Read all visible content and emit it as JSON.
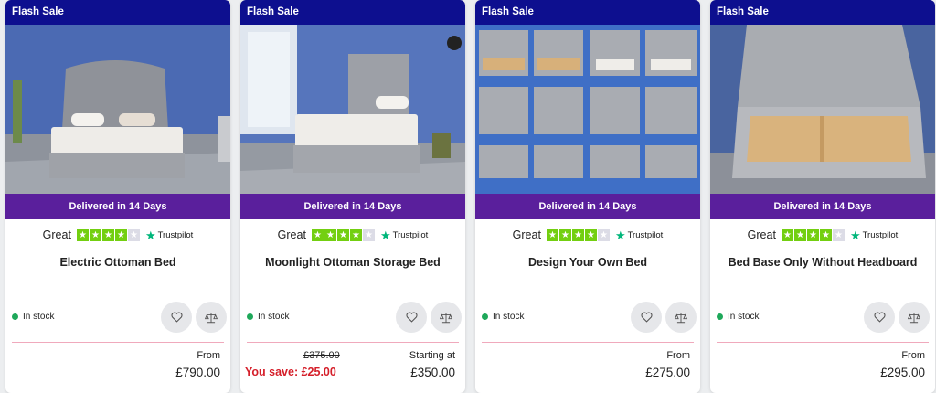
{
  "colors": {
    "flash_bg": "#0d0f8f",
    "delivery_bg": "#5a1f9c",
    "trustpilot_green": "#73cf11",
    "in_stock_dot": "#1ea85a",
    "save_red": "#d51f2a"
  },
  "icons": {
    "wishlist": "heart-icon",
    "compare": "scales-icon",
    "trustpilot": "trustpilot-star-icon"
  },
  "products": [
    {
      "badge": "Flash Sale",
      "delivery": "Delivered in 14 Days",
      "rating_label": "Great",
      "rating_stars": 4,
      "trustpilot": "Trustpilot",
      "name": "Electric Ottoman Bed",
      "stock": "In stock",
      "price_label": "From",
      "price": "£790.00"
    },
    {
      "badge": "Flash Sale",
      "delivery": "Delivered in 14 Days",
      "rating_label": "Great",
      "rating_stars": 4,
      "trustpilot": "Trustpilot",
      "name": "Moonlight Ottoman Storage Bed",
      "stock": "In stock",
      "was_price": "£375.00",
      "saving": "You save: £25.00",
      "price_label": "Starting at",
      "price": "£350.00"
    },
    {
      "badge": "Flash Sale",
      "delivery": "Delivered in 14 Days",
      "rating_label": "Great",
      "rating_stars": 4,
      "trustpilot": "Trustpilot",
      "name": "Design Your Own Bed",
      "stock": "In stock",
      "price_label": "From",
      "price": "£275.00"
    },
    {
      "badge": "Flash Sale",
      "delivery": "Delivered in 14 Days",
      "rating_label": "Great",
      "rating_stars": 4,
      "trustpilot": "Trustpilot",
      "name": "Bed Base Only Without Headboard",
      "stock": "In stock",
      "price_label": "From",
      "price": "£295.00"
    }
  ]
}
